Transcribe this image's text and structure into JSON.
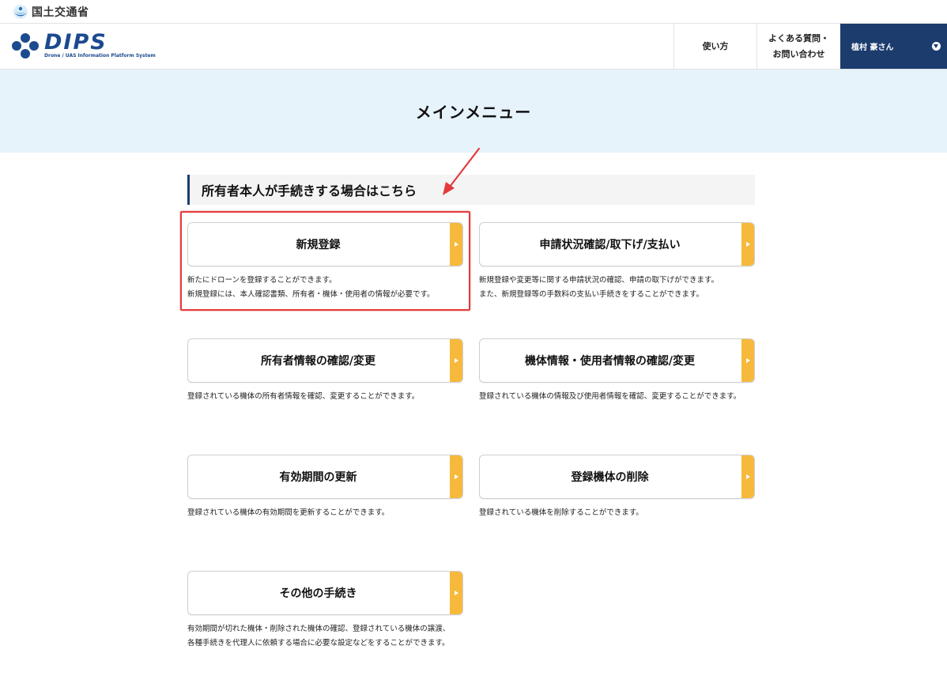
{
  "ministry": {
    "name": "国土交通省"
  },
  "header": {
    "logo_text": "DIPS",
    "logo_subtitle": "Drone / UAS Information Platform System",
    "nav": {
      "howto": "使い方",
      "faq_line1": "よくある質問・",
      "faq_line2": "お問い合わせ",
      "user": "植村 豪さん"
    }
  },
  "page": {
    "title": "メインメニュー",
    "section_heading": "所有者本人が手続きする場合はこちら"
  },
  "menu": [
    {
      "label": "新規登録",
      "desc": [
        "新たにドローンを登録することができます。",
        "新規登録には、本人確認書類、所有者・機体・使用者の情報が必要です。"
      ]
    },
    {
      "label": "申請状況確認/取下げ/支払い",
      "desc": [
        "新規登録や変更等に関する申請状況の確認、申請の取下げができます。",
        "また、新規登録等の手数料の支払い手続きをすることができます。"
      ]
    },
    {
      "label": "所有者情報の確認/変更",
      "desc": [
        "登録されている機体の所有者情報を確認、変更することができます。"
      ]
    },
    {
      "label": "機体情報・使用者情報の確認/変更",
      "desc": [
        "登録されている機体の情報及び使用者情報を確認、変更することができます。"
      ]
    },
    {
      "label": "有効期間の更新",
      "desc": [
        "登録されている機体の有効期間を更新することができます。"
      ]
    },
    {
      "label": "登録機体の削除",
      "desc": [
        "登録されている機体を削除することができます。"
      ]
    },
    {
      "label": "その他の手続き",
      "desc": [
        "有効期間が切れた機体・削除された機体の確認、登録されている機体の譲渡、",
        "各種手続きを代理人に依頼する場合に必要な設定などをすることができます。"
      ]
    }
  ],
  "colors": {
    "brand_navy": "#1c3c6e",
    "hero_bg": "#e6f3fb",
    "tab_orange": "#f6b93b",
    "annotation_red": "#e23b3b"
  },
  "icons": [
    "mlit-logo-icon",
    "dips-logo-icon",
    "chevron-down-icon",
    "arrow-right-icon"
  ]
}
